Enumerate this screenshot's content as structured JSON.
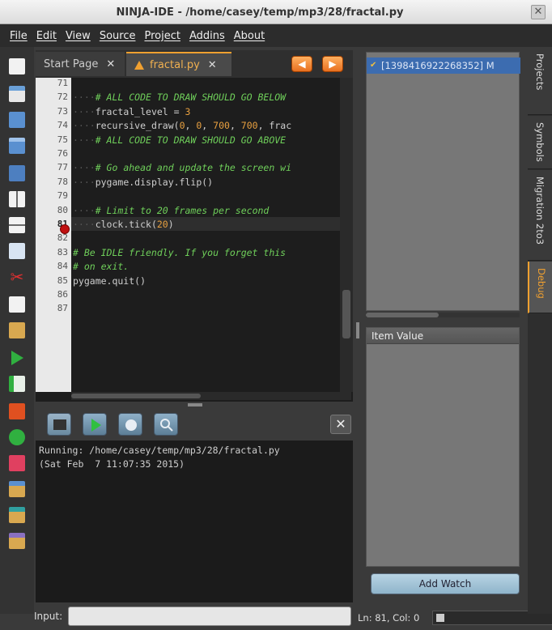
{
  "window": {
    "title": "NINJA-IDE - /home/casey/temp/mp3/28/fractal.py",
    "close_glyph": "✕"
  },
  "menu": [
    "File",
    "Edit",
    "View",
    "Source",
    "Project",
    "Addins",
    "About"
  ],
  "tabs": [
    {
      "label": "Start Page",
      "close": "✕"
    },
    {
      "label": "fractal.py",
      "close": "✕"
    }
  ],
  "editor": {
    "line_numbers": [
      "71",
      "72",
      "73",
      "74",
      "75",
      "76",
      "77",
      "78",
      "79",
      "80",
      "81",
      "82",
      "83",
      "84",
      "85",
      "86",
      "87"
    ],
    "current_line": "81",
    "breakpoint_line": "81",
    "lines": [
      "",
      "    # ALL CODE TO DRAW SHOULD GO BELOW",
      "    fractal_level = 3",
      "    recursive_draw(0, 0, 700, 700, frac",
      "    # ALL CODE TO DRAW SHOULD GO ABOVE",
      "",
      "    # Go ahead and update the screen wi",
      "    pygame.display.flip()",
      "",
      "    # Limit to 20 frames per second",
      "    clock.tick(20)",
      "",
      "# Be IDLE friendly. If you forget this",
      "# on exit.",
      "pygame.quit()",
      "",
      ""
    ]
  },
  "console": {
    "lines": [
      "Running: /home/casey/temp/mp3/28/fractal.py",
      "(Sat Feb  7 11:07:35 2015)"
    ],
    "close_glyph": "✕"
  },
  "input": {
    "label": "Input:"
  },
  "explorer": {
    "project_item": "[1398416922268352] M",
    "watch_header": "Item  Value",
    "add_watch": "Add Watch"
  },
  "status": {
    "cursor": "Ln: 81, Col: 0"
  },
  "side_tabs": [
    "Projects",
    "Symbols",
    "Migration 2to3",
    "Debug"
  ],
  "colors": {
    "accent": "#f0a030",
    "selection": "#3c6cb0",
    "comment": "#6fcf5a",
    "number": "#e8a040"
  }
}
